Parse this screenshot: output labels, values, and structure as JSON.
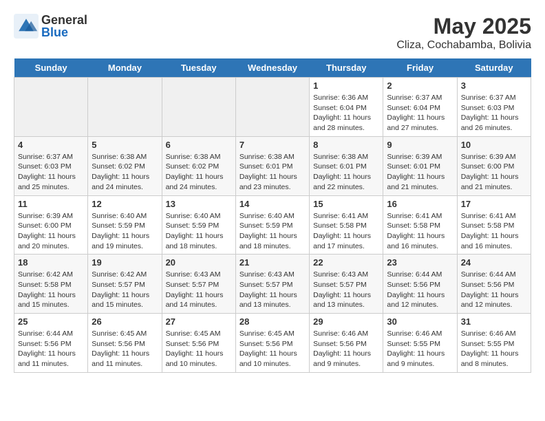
{
  "header": {
    "logo_general": "General",
    "logo_blue": "Blue",
    "title": "May 2025",
    "subtitle": "Cliza, Cochabamba, Bolivia"
  },
  "days_of_week": [
    "Sunday",
    "Monday",
    "Tuesday",
    "Wednesday",
    "Thursday",
    "Friday",
    "Saturday"
  ],
  "weeks": [
    [
      {
        "day": "",
        "empty": true
      },
      {
        "day": "",
        "empty": true
      },
      {
        "day": "",
        "empty": true
      },
      {
        "day": "",
        "empty": true
      },
      {
        "day": "1",
        "sunrise": "6:36 AM",
        "sunset": "6:04 PM",
        "daylight": "11 hours and 28 minutes."
      },
      {
        "day": "2",
        "sunrise": "6:37 AM",
        "sunset": "6:04 PM",
        "daylight": "11 hours and 27 minutes."
      },
      {
        "day": "3",
        "sunrise": "6:37 AM",
        "sunset": "6:03 PM",
        "daylight": "11 hours and 26 minutes."
      }
    ],
    [
      {
        "day": "4",
        "sunrise": "6:37 AM",
        "sunset": "6:03 PM",
        "daylight": "11 hours and 25 minutes."
      },
      {
        "day": "5",
        "sunrise": "6:38 AM",
        "sunset": "6:02 PM",
        "daylight": "11 hours and 24 minutes."
      },
      {
        "day": "6",
        "sunrise": "6:38 AM",
        "sunset": "6:02 PM",
        "daylight": "11 hours and 24 minutes."
      },
      {
        "day": "7",
        "sunrise": "6:38 AM",
        "sunset": "6:01 PM",
        "daylight": "11 hours and 23 minutes."
      },
      {
        "day": "8",
        "sunrise": "6:38 AM",
        "sunset": "6:01 PM",
        "daylight": "11 hours and 22 minutes."
      },
      {
        "day": "9",
        "sunrise": "6:39 AM",
        "sunset": "6:01 PM",
        "daylight": "11 hours and 21 minutes."
      },
      {
        "day": "10",
        "sunrise": "6:39 AM",
        "sunset": "6:00 PM",
        "daylight": "11 hours and 21 minutes."
      }
    ],
    [
      {
        "day": "11",
        "sunrise": "6:39 AM",
        "sunset": "6:00 PM",
        "daylight": "11 hours and 20 minutes."
      },
      {
        "day": "12",
        "sunrise": "6:40 AM",
        "sunset": "5:59 PM",
        "daylight": "11 hours and 19 minutes."
      },
      {
        "day": "13",
        "sunrise": "6:40 AM",
        "sunset": "5:59 PM",
        "daylight": "11 hours and 18 minutes."
      },
      {
        "day": "14",
        "sunrise": "6:40 AM",
        "sunset": "5:59 PM",
        "daylight": "11 hours and 18 minutes."
      },
      {
        "day": "15",
        "sunrise": "6:41 AM",
        "sunset": "5:58 PM",
        "daylight": "11 hours and 17 minutes."
      },
      {
        "day": "16",
        "sunrise": "6:41 AM",
        "sunset": "5:58 PM",
        "daylight": "11 hours and 16 minutes."
      },
      {
        "day": "17",
        "sunrise": "6:41 AM",
        "sunset": "5:58 PM",
        "daylight": "11 hours and 16 minutes."
      }
    ],
    [
      {
        "day": "18",
        "sunrise": "6:42 AM",
        "sunset": "5:58 PM",
        "daylight": "11 hours and 15 minutes."
      },
      {
        "day": "19",
        "sunrise": "6:42 AM",
        "sunset": "5:57 PM",
        "daylight": "11 hours and 15 minutes."
      },
      {
        "day": "20",
        "sunrise": "6:43 AM",
        "sunset": "5:57 PM",
        "daylight": "11 hours and 14 minutes."
      },
      {
        "day": "21",
        "sunrise": "6:43 AM",
        "sunset": "5:57 PM",
        "daylight": "11 hours and 13 minutes."
      },
      {
        "day": "22",
        "sunrise": "6:43 AM",
        "sunset": "5:57 PM",
        "daylight": "11 hours and 13 minutes."
      },
      {
        "day": "23",
        "sunrise": "6:44 AM",
        "sunset": "5:56 PM",
        "daylight": "11 hours and 12 minutes."
      },
      {
        "day": "24",
        "sunrise": "6:44 AM",
        "sunset": "5:56 PM",
        "daylight": "11 hours and 12 minutes."
      }
    ],
    [
      {
        "day": "25",
        "sunrise": "6:44 AM",
        "sunset": "5:56 PM",
        "daylight": "11 hours and 11 minutes."
      },
      {
        "day": "26",
        "sunrise": "6:45 AM",
        "sunset": "5:56 PM",
        "daylight": "11 hours and 11 minutes."
      },
      {
        "day": "27",
        "sunrise": "6:45 AM",
        "sunset": "5:56 PM",
        "daylight": "11 hours and 10 minutes."
      },
      {
        "day": "28",
        "sunrise": "6:45 AM",
        "sunset": "5:56 PM",
        "daylight": "11 hours and 10 minutes."
      },
      {
        "day": "29",
        "sunrise": "6:46 AM",
        "sunset": "5:56 PM",
        "daylight": "11 hours and 9 minutes."
      },
      {
        "day": "30",
        "sunrise": "6:46 AM",
        "sunset": "5:55 PM",
        "daylight": "11 hours and 9 minutes."
      },
      {
        "day": "31",
        "sunrise": "6:46 AM",
        "sunset": "5:55 PM",
        "daylight": "11 hours and 8 minutes."
      }
    ]
  ]
}
